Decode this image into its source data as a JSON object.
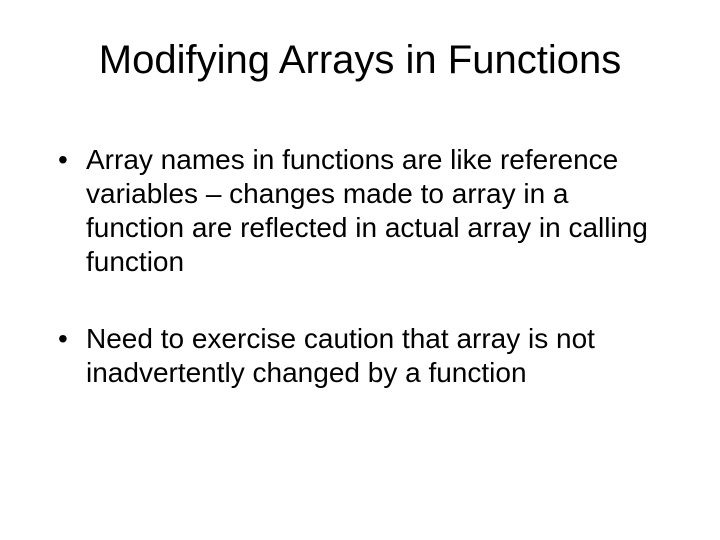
{
  "slide": {
    "title": "Modifying Arrays in Functions",
    "bullets": [
      "Array names in functions are like reference variables – changes made to array in a function are reflected in actual array in calling function",
      "Need to exercise caution that array is not inadvertently changed by a function"
    ]
  }
}
